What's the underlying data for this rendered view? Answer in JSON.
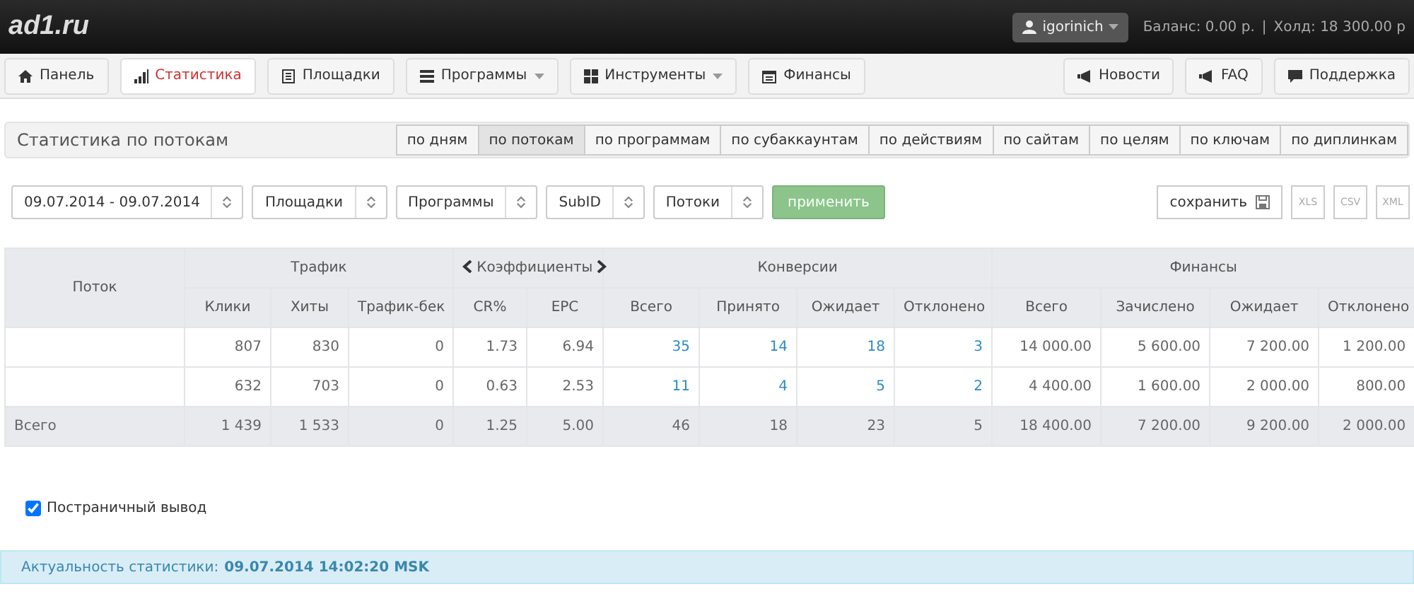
{
  "header": {
    "logo": "ad1.ru",
    "user": "igorinich",
    "balance": "Баланс: 0.00 р.",
    "separator": "|",
    "hold": "Холд: 18 300.00 р"
  },
  "nav": {
    "left": [
      {
        "label": "Панель",
        "selected": false,
        "dropdown": false
      },
      {
        "label": "Статистика",
        "selected": true,
        "dropdown": false
      },
      {
        "label": "Площадки",
        "selected": false,
        "dropdown": false
      },
      {
        "label": "Программы",
        "selected": false,
        "dropdown": true
      },
      {
        "label": "Инструменты",
        "selected": false,
        "dropdown": true
      },
      {
        "label": "Финансы",
        "selected": false,
        "dropdown": false
      }
    ],
    "right": [
      {
        "label": "Новости",
        "selected": false,
        "dropdown": false
      },
      {
        "label": "FAQ",
        "selected": false,
        "dropdown": false
      },
      {
        "label": "Поддержка",
        "selected": false,
        "dropdown": false
      }
    ]
  },
  "section": {
    "title": "Статистика по потокам",
    "tabs": [
      {
        "label": "по дням",
        "selected": false
      },
      {
        "label": "по потокам",
        "selected": true
      },
      {
        "label": "по программам",
        "selected": false
      },
      {
        "label": "по субаккаунтам",
        "selected": false
      },
      {
        "label": "по действиям",
        "selected": false
      },
      {
        "label": "по сайтам",
        "selected": false
      },
      {
        "label": "по целям",
        "selected": false
      },
      {
        "label": "по ключам",
        "selected": false
      },
      {
        "label": "по диплинкам",
        "selected": false
      }
    ]
  },
  "filters": {
    "selects": [
      "09.07.2014 - 09.07.2014",
      "Площадки",
      "Программы",
      "SubID",
      "Потоки"
    ],
    "apply": "применить",
    "save": "сохранить",
    "exports": [
      "XLS",
      "CSV",
      "XML"
    ]
  },
  "table": {
    "first_column": "Поток",
    "groups": [
      {
        "label": "Трафик",
        "arrows": false,
        "links": false,
        "columns": [
          "Клики",
          "Хиты",
          "Трафик-бек"
        ]
      },
      {
        "label": "Коэффициенты",
        "arrows": true,
        "links": false,
        "columns": [
          "CR%",
          "EPC"
        ]
      },
      {
        "label": "Конверсии",
        "arrows": false,
        "links": true,
        "columns": [
          "Всего",
          "Принято",
          "Ожидает",
          "Отклонено"
        ]
      },
      {
        "label": "Финансы",
        "arrows": false,
        "links": false,
        "columns": [
          "Всего",
          "Зачислено",
          "Ожидает",
          "Отклонено"
        ]
      }
    ],
    "rows": [
      {
        "kind": "data",
        "cells": [
          "807",
          "830",
          "0",
          "1.73",
          "6.94",
          "35",
          "14",
          "18",
          "3",
          "14 000.00",
          "5 600.00",
          "7 200.00",
          "1 200.00"
        ]
      },
      {
        "kind": "data",
        "cells": [
          "632",
          "703",
          "0",
          "0.63",
          "2.53",
          "11",
          "4",
          "5",
          "2",
          "4 400.00",
          "1 600.00",
          "2 000.00",
          "800.00"
        ]
      },
      {
        "kind": "total",
        "label": "Всего",
        "cells": [
          "1 439",
          "1 533",
          "0",
          "1.25",
          "5.00",
          "46",
          "18",
          "23",
          "5",
          "18 400.00",
          "7 200.00",
          "9 200.00",
          "2 000.00"
        ]
      }
    ]
  },
  "paging": {
    "label": "Постраничный вывод",
    "checked": true
  },
  "footer": {
    "label": "Актуальность статистики:",
    "value": "09.07.2014 14:02:20 MSK"
  }
}
